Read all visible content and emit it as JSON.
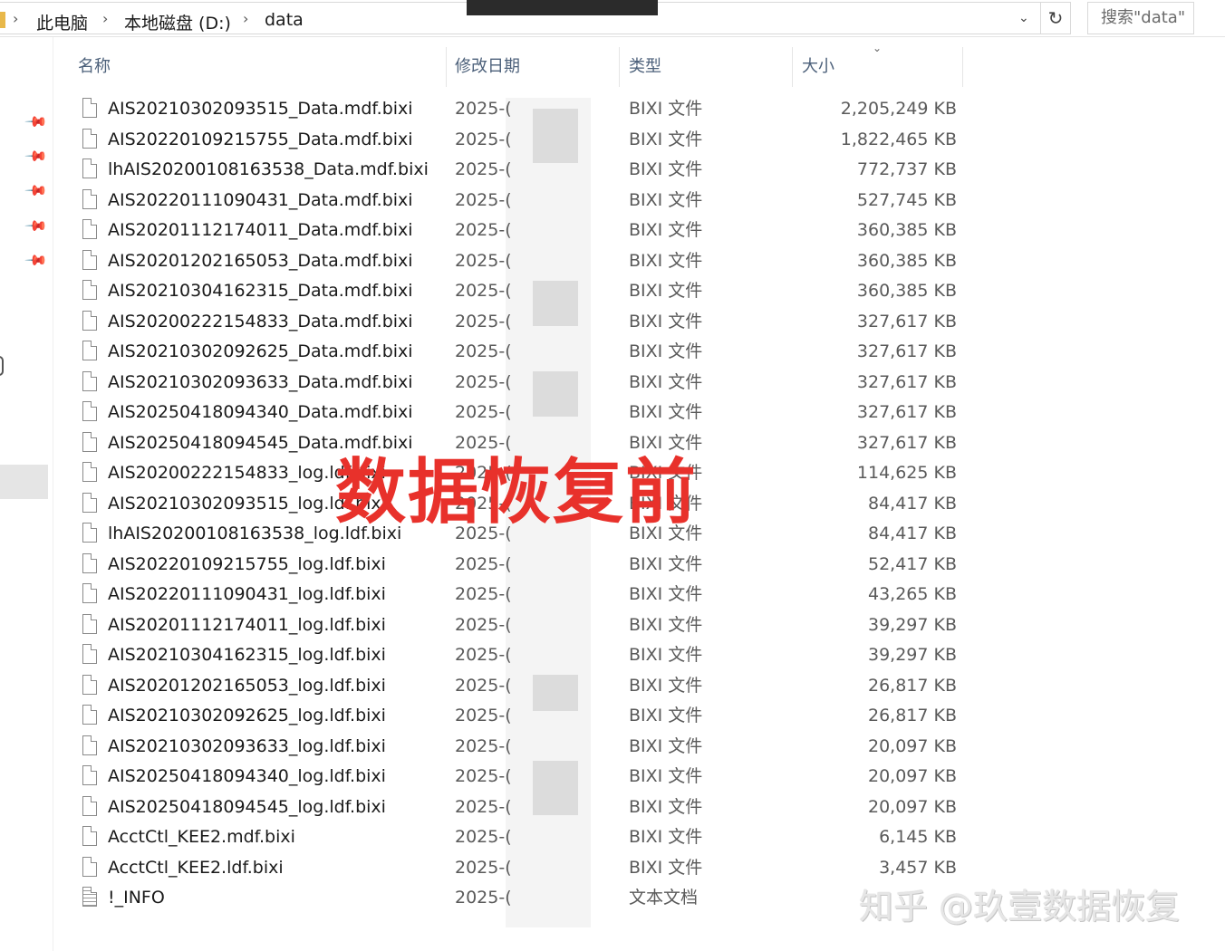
{
  "address_bar": {
    "crumbs": [
      "此电脑",
      "本地磁盘 (D:)",
      "data"
    ],
    "search_placeholder": "搜索\"data\""
  },
  "columns": {
    "name": "名称",
    "date": "修改日期",
    "type": "类型",
    "size": "大小"
  },
  "files": [
    {
      "name": "AIS20210302093515_Data.mdf.bixi",
      "date": "2025-(",
      "type": "BIXI 文件",
      "size": "2,205,249 KB"
    },
    {
      "name": "AIS20220109215755_Data.mdf.bixi",
      "date": "2025-(",
      "type": "BIXI 文件",
      "size": "1,822,465 KB"
    },
    {
      "name": "lhAIS20200108163538_Data.mdf.bixi",
      "date": "2025-(",
      "type": "BIXI 文件",
      "size": "772,737 KB"
    },
    {
      "name": "AIS20220111090431_Data.mdf.bixi",
      "date": "2025-(",
      "type": "BIXI 文件",
      "size": "527,745 KB"
    },
    {
      "name": "AIS20201112174011_Data.mdf.bixi",
      "date": "2025-(",
      "type": "BIXI 文件",
      "size": "360,385 KB"
    },
    {
      "name": "AIS20201202165053_Data.mdf.bixi",
      "date": "2025-(",
      "type": "BIXI 文件",
      "size": "360,385 KB"
    },
    {
      "name": "AIS20210304162315_Data.mdf.bixi",
      "date": "2025-(",
      "type": "BIXI 文件",
      "size": "360,385 KB"
    },
    {
      "name": "AIS20200222154833_Data.mdf.bixi",
      "date": "2025-(",
      "type": "BIXI 文件",
      "size": "327,617 KB"
    },
    {
      "name": "AIS20210302092625_Data.mdf.bixi",
      "date": "2025-(",
      "type": "BIXI 文件",
      "size": "327,617 KB"
    },
    {
      "name": "AIS20210302093633_Data.mdf.bixi",
      "date": "2025-(",
      "type": "BIXI 文件",
      "size": "327,617 KB"
    },
    {
      "name": "AIS20250418094340_Data.mdf.bixi",
      "date": "2025-(",
      "type": "BIXI 文件",
      "size": "327,617 KB"
    },
    {
      "name": "AIS20250418094545_Data.mdf.bixi",
      "date": "2025-(",
      "type": "BIXI 文件",
      "size": "327,617 KB"
    },
    {
      "name": "AIS20200222154833_log.ldf.bixi",
      "date": "2025-(",
      "type": "BIXI 文件",
      "size": "114,625 KB"
    },
    {
      "name": "AIS20210302093515_log.ldf.bixi",
      "date": "2025-(",
      "type": "BIXI 文件",
      "size": "84,417 KB"
    },
    {
      "name": "lhAIS20200108163538_log.ldf.bixi",
      "date": "2025-(",
      "type": "BIXI 文件",
      "size": "84,417 KB"
    },
    {
      "name": "AIS20220109215755_log.ldf.bixi",
      "date": "2025-(",
      "type": "BIXI 文件",
      "size": "52,417 KB"
    },
    {
      "name": "AIS20220111090431_log.ldf.bixi",
      "date": "2025-(",
      "type": "BIXI 文件",
      "size": "43,265 KB"
    },
    {
      "name": "AIS20201112174011_log.ldf.bixi",
      "date": "2025-(",
      "type": "BIXI 文件",
      "size": "39,297 KB"
    },
    {
      "name": "AIS20210304162315_log.ldf.bixi",
      "date": "2025-(",
      "type": "BIXI 文件",
      "size": "39,297 KB"
    },
    {
      "name": "AIS20201202165053_log.ldf.bixi",
      "date": "2025-(",
      "type": "BIXI 文件",
      "size": "26,817 KB"
    },
    {
      "name": "AIS20210302092625_log.ldf.bixi",
      "date": "2025-(",
      "type": "BIXI 文件",
      "size": "26,817 KB"
    },
    {
      "name": "AIS20210302093633_log.ldf.bixi",
      "date": "2025-(",
      "type": "BIXI 文件",
      "size": "20,097 KB"
    },
    {
      "name": "AIS20250418094340_log.ldf.bixi",
      "date": "2025-(",
      "type": "BIXI 文件",
      "size": "20,097 KB"
    },
    {
      "name": "AIS20250418094545_log.ldf.bixi",
      "date": "2025-(",
      "type": "BIXI 文件",
      "size": "20,097 KB"
    },
    {
      "name": "AcctCtl_KEE2.mdf.bixi",
      "date": "2025-(",
      "type": "BIXI 文件",
      "size": "6,145 KB"
    },
    {
      "name": "AcctCtl_KEE2.ldf.bixi",
      "date": "2025-(",
      "type": "BIXI 文件",
      "size": "3,457 KB"
    },
    {
      "name": "!_INFO",
      "date": "2025-(",
      "type": "文本文档",
      "size": "",
      "icon": "text-document-icon"
    }
  ],
  "overlay_text": "数据恢复前",
  "watermark": "知乎 @玖壹数据恢复",
  "colors": {
    "overlay_red": "#e8312b",
    "header_text": "#4c607a",
    "nav_selected": "#e5e5e5"
  }
}
